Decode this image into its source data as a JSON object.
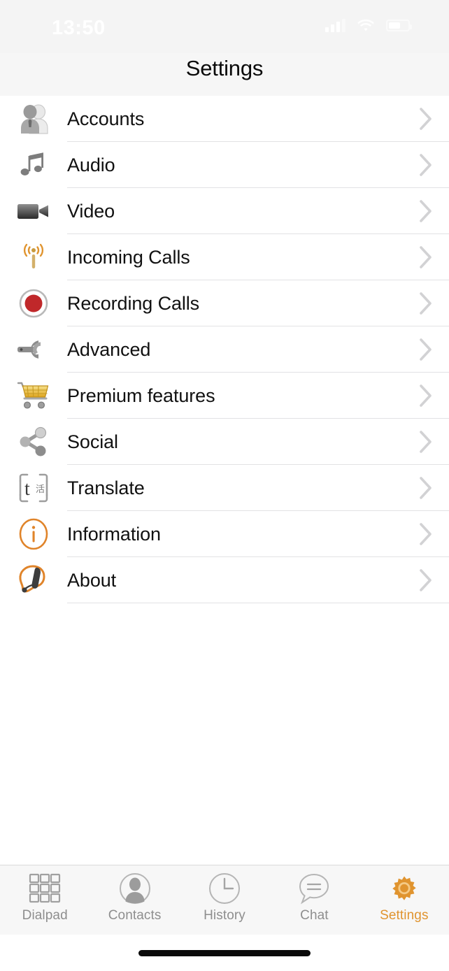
{
  "status_bar": {
    "time": "13:50",
    "icons": [
      "cellular-signal-icon",
      "wifi-icon",
      "battery-icon"
    ]
  },
  "nav": {
    "title": "Settings"
  },
  "colors": {
    "accent_orange": "#e0942f",
    "record_red": "#c0282a",
    "cart_gold": "#e8b93c",
    "icon_gray": "#8c8c8c",
    "separator": "#e2e2e4",
    "nav_background": "#f6f6f6",
    "tabbar_background": "#f7f7f7",
    "label_text": "#111111",
    "tab_inactive_text": "#8e8e8e"
  },
  "settings_list": {
    "items": [
      {
        "label": "Accounts",
        "icon": "accounts-icon",
        "chevron": "chevron-right-icon"
      },
      {
        "label": "Audio",
        "icon": "audio-note-icon",
        "chevron": "chevron-right-icon"
      },
      {
        "label": "Video",
        "icon": "video-camera-icon",
        "chevron": "chevron-right-icon"
      },
      {
        "label": "Incoming Calls",
        "icon": "antenna-icon",
        "chevron": "chevron-right-icon"
      },
      {
        "label": "Recording Calls",
        "icon": "record-icon",
        "chevron": "chevron-right-icon"
      },
      {
        "label": "Advanced",
        "icon": "wrench-icon",
        "chevron": "chevron-right-icon"
      },
      {
        "label": "Premium features",
        "icon": "shopping-cart-icon",
        "chevron": "chevron-right-icon"
      },
      {
        "label": "Social",
        "icon": "share-icon",
        "chevron": "chevron-right-icon"
      },
      {
        "label": "Translate",
        "icon": "translate-icon",
        "chevron": "chevron-right-icon"
      },
      {
        "label": "Information",
        "icon": "info-circle-icon",
        "chevron": "chevron-right-icon"
      },
      {
        "label": "About",
        "icon": "headset-icon",
        "chevron": "chevron-right-icon"
      }
    ]
  },
  "translate_icon_glyphs": {
    "latin": "t",
    "cjk": "活"
  },
  "tab_bar": {
    "items": [
      {
        "label": "Dialpad",
        "icon": "dialpad-grid-icon",
        "active": false
      },
      {
        "label": "Contacts",
        "icon": "contacts-person-icon",
        "active": false
      },
      {
        "label": "History",
        "icon": "clock-icon",
        "active": false
      },
      {
        "label": "Chat",
        "icon": "chat-bubble-icon",
        "active": false
      },
      {
        "label": "Settings",
        "icon": "gear-icon",
        "active": true
      }
    ]
  },
  "home_indicator": {
    "name": "home-indicator-bar"
  }
}
